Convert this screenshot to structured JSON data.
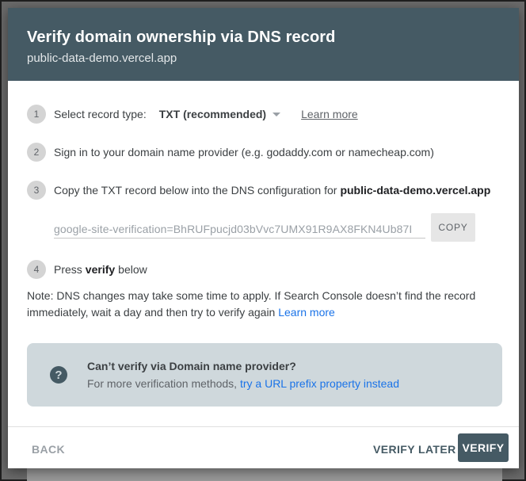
{
  "dialog": {
    "title": "Verify domain ownership via DNS record",
    "subtitle": "public-data-demo.vercel.app"
  },
  "steps": [
    {
      "number": "1",
      "label": "Select record type:",
      "select_value": "TXT (recommended)",
      "link": "Learn more"
    },
    {
      "number": "2",
      "text": "Sign in to your domain name provider (e.g. godaddy.com or namecheap.com)"
    },
    {
      "number": "3",
      "text": "Copy the TXT record below into the DNS configuration for",
      "domain": "public-data-demo.vercel.app"
    },
    {
      "number": "4",
      "text_before": "Press",
      "text_bold": "verify",
      "text_after": "below"
    }
  ],
  "record": {
    "value": "google-site-verification=BhRUFpucjd03bVvc7UMX91R9AX8FKN4Ub87I",
    "copy_label": "COPY"
  },
  "note": {
    "text": "Note: DNS changes may take some time to apply. If Search Console doesn’t find the record immediately, wait a day and then try to verify again",
    "link": "Learn more"
  },
  "help": {
    "icon": "?",
    "title": "Can’t verify via Domain name provider?",
    "desc": "For more verification methods,",
    "link": "try a URL prefix property instead"
  },
  "footer": {
    "back_label": "BACK",
    "verify_later_label": "VERIFY LATER",
    "verify_label": "VERIFY"
  },
  "colors": {
    "header_bg": "#455a64",
    "link": "#1a73e8",
    "help_bg": "#cfd8dc"
  }
}
